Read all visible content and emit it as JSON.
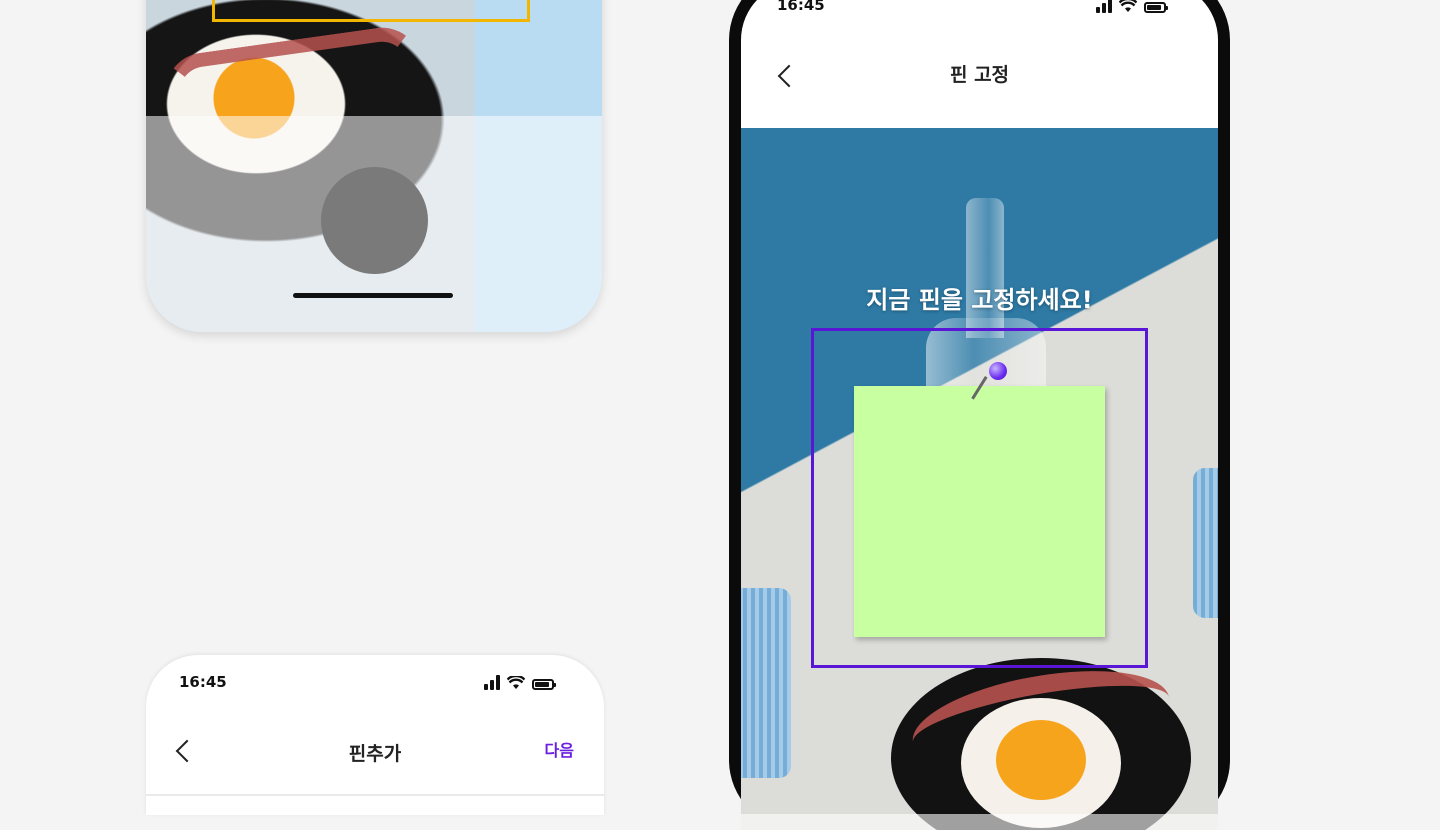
{
  "screens": {
    "camera": {
      "frame_color": "#f2b600",
      "shutter_color": "#7a7a7a"
    },
    "add_pin": {
      "status_time": "16:45",
      "title": "핀추가",
      "next_label": "다음",
      "accent": "#6a1fe0"
    },
    "pin_fix": {
      "status_time": "16:45",
      "title": "핀 고정",
      "prompt": "지금 핀을 고정하세요!",
      "frame_color": "#5a16d6",
      "sticky_color": "#c8ffa0"
    }
  },
  "icons": [
    "back-chevron-icon",
    "signal-icon",
    "wifi-icon",
    "battery-icon",
    "pin-icon"
  ]
}
